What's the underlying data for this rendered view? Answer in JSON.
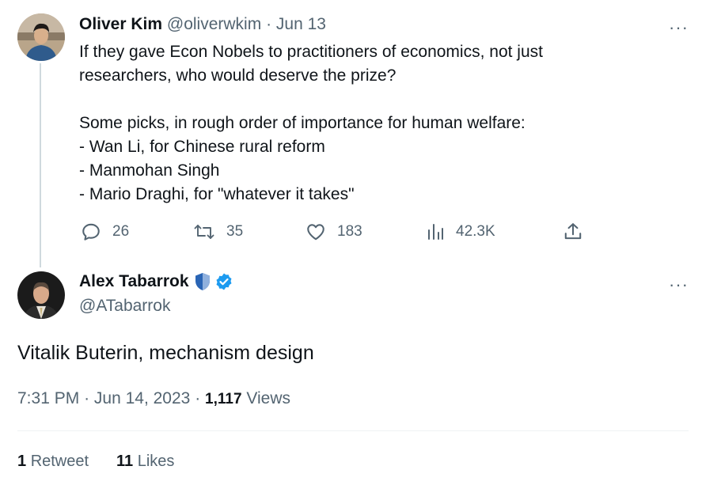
{
  "parent_tweet": {
    "author_name": "Oliver Kim",
    "handle": "@oliverwkim",
    "separator": "·",
    "date": "Jun 13",
    "text": "If they gave Econ Nobels to practitioners of economics, not just\nresearchers, who would deserve the prize?\n\nSome picks, in rough order of importance for human welfare:\n- Wan Li, for Chinese rural reform\n- Manmohan Singh\n- Mario Draghi, for \"whatever it takes\"",
    "actions": {
      "replies": "26",
      "retweets": "35",
      "likes": "183",
      "views": "42.3K"
    },
    "more_label": "···"
  },
  "main_tweet": {
    "author_name": "Alex Tabarrok",
    "handle": "@ATabarrok",
    "text": "Vitalik Buterin, mechanism design",
    "time": "7:31 PM",
    "separator": "·",
    "date": "Jun 14, 2023",
    "views_count": "1,117",
    "views_label": "Views",
    "retweet_count": "1",
    "retweet_label": "Retweet",
    "like_count": "11",
    "like_label": "Likes",
    "more_label": "···",
    "badges": [
      "shield-icon",
      "verified-icon"
    ]
  },
  "colors": {
    "text": "#0f1419",
    "secondary": "#536471",
    "verified_blue": "#1d9bf0",
    "shield_blue": "#2a65b5",
    "divider": "#eff3f4"
  }
}
